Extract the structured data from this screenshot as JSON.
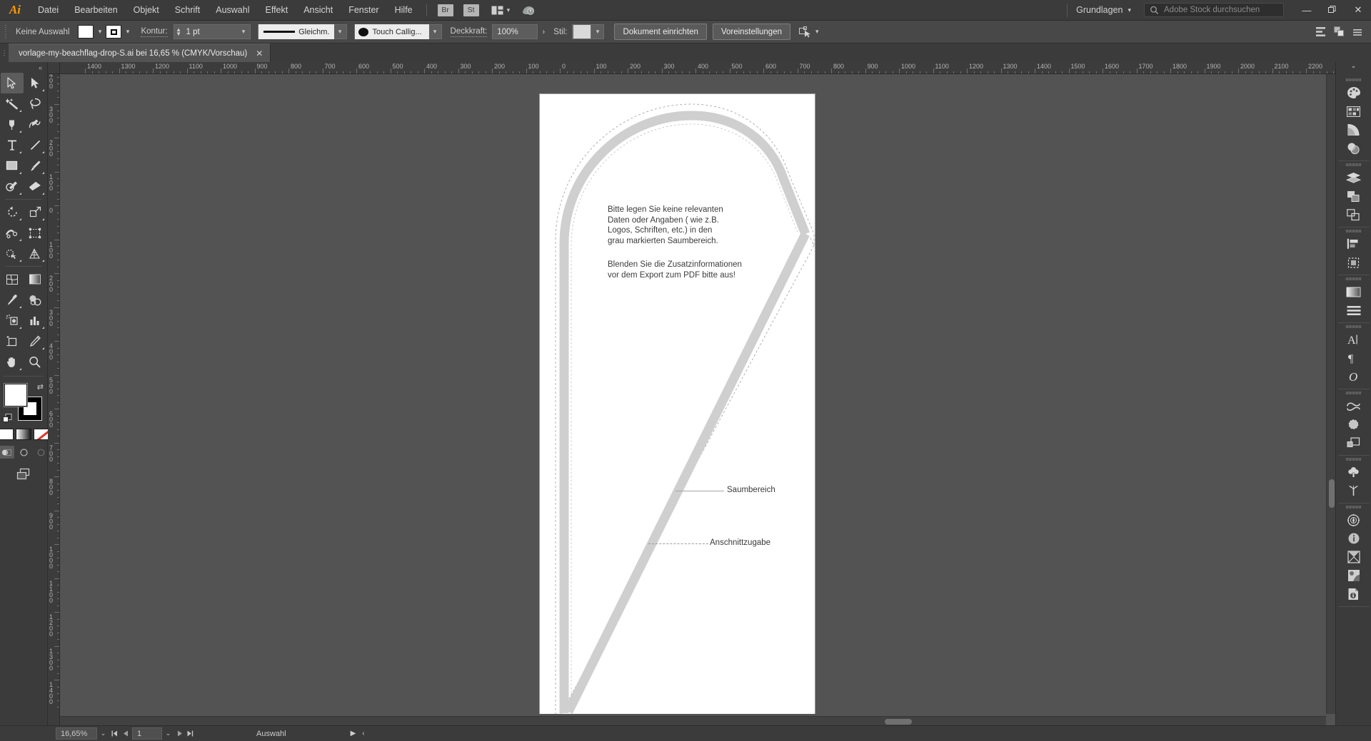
{
  "app": {
    "name": "Adobe Illustrator",
    "logo_text": "Ai"
  },
  "menubar": {
    "items": [
      {
        "label": "Datei"
      },
      {
        "label": "Bearbeiten"
      },
      {
        "label": "Objekt"
      },
      {
        "label": "Schrift"
      },
      {
        "label": "Auswahl"
      },
      {
        "label": "Effekt"
      },
      {
        "label": "Ansicht"
      },
      {
        "label": "Fenster"
      },
      {
        "label": "Hilfe"
      }
    ],
    "bridge_button": "Br",
    "stock_button": "St",
    "arrange_icon": "arrange-documents-icon",
    "cloud_icon": "creative-cloud-icon",
    "workspace": {
      "label": "Grundlagen",
      "caret": "⌄"
    },
    "stock_search": {
      "placeholder": "Adobe Stock durchsuchen",
      "icon": "search-icon"
    },
    "window_controls": {
      "minimize": "—",
      "maximize": "❐",
      "close": "✕"
    }
  },
  "controlbar": {
    "selection_state": "Keine Auswahl",
    "fill_swatch": "#ffffff",
    "stroke_swatch": "#ffffff",
    "stroke_label": "Kontur:",
    "stroke_weight": "1 pt",
    "stroke_profile": "Gleichm.",
    "brush_label": "Touch Callig...",
    "opacity_label": "Deckkraft:",
    "opacity_value": "100%",
    "style_label": "Stil:",
    "style_swatch": "#d9d9d9",
    "document_setup_button": "Dokument einrichten",
    "preferences_button": "Voreinstellungen",
    "select_similar_icon": "select-similar-objects-icon",
    "align_icon": "align-icon",
    "arrange_icon": "arrange-icon",
    "more_options_icon": "more-options-icon"
  },
  "tab": {
    "title": "vorlage-my-beachflag-drop-S.ai bei 16,65 % (CMYK/Vorschau)",
    "close": "✕"
  },
  "toolbar": {
    "collapse": "«",
    "tools": [
      {
        "name": "selection-tool",
        "active": true,
        "corner": false
      },
      {
        "name": "direct-selection-tool",
        "active": false,
        "corner": true
      },
      {
        "name": "magic-wand-tool",
        "active": false,
        "corner": true
      },
      {
        "name": "lasso-tool",
        "active": false,
        "corner": false
      },
      {
        "name": "pen-tool",
        "active": false,
        "corner": true
      },
      {
        "name": "curvature-tool",
        "active": false,
        "corner": false
      },
      {
        "name": "type-tool",
        "active": false,
        "corner": true
      },
      {
        "name": "line-segment-tool",
        "active": false,
        "corner": true
      },
      {
        "name": "rectangle-tool",
        "active": false,
        "corner": true
      },
      {
        "name": "paintbrush-tool",
        "active": false,
        "corner": true
      },
      {
        "name": "shaper-tool",
        "active": false,
        "corner": true
      },
      {
        "name": "eraser-tool",
        "active": false,
        "corner": true
      },
      {
        "name": "rotate-tool",
        "active": false,
        "corner": true
      },
      {
        "name": "scale-tool",
        "active": false,
        "corner": true
      },
      {
        "name": "width-tool",
        "active": false,
        "corner": true
      },
      {
        "name": "free-transform-tool",
        "active": false,
        "corner": false
      },
      {
        "name": "shape-builder-tool",
        "active": false,
        "corner": true
      },
      {
        "name": "perspective-grid-tool",
        "active": false,
        "corner": true
      },
      {
        "name": "mesh-tool",
        "active": false,
        "corner": false
      },
      {
        "name": "gradient-tool",
        "active": false,
        "corner": false
      },
      {
        "name": "eyedropper-tool",
        "active": false,
        "corner": true
      },
      {
        "name": "blend-tool",
        "active": false,
        "corner": false
      },
      {
        "name": "symbol-sprayer-tool",
        "active": false,
        "corner": true
      },
      {
        "name": "column-graph-tool",
        "active": false,
        "corner": true
      },
      {
        "name": "artboard-tool",
        "active": false,
        "corner": false
      },
      {
        "name": "slice-tool",
        "active": false,
        "corner": true
      },
      {
        "name": "hand-tool",
        "active": false,
        "corner": true
      },
      {
        "name": "zoom-tool",
        "active": false,
        "corner": false
      }
    ],
    "fill_color": "#ffffff",
    "stroke_color": "#000000",
    "swap_icon": "swap-fill-stroke-icon",
    "default_icon": "default-fill-stroke-icon",
    "color_modes": [
      {
        "name": "color-mode-button",
        "type": "solid"
      },
      {
        "name": "gradient-mode-button",
        "type": "gradient"
      },
      {
        "name": "none-mode-button",
        "type": "none"
      }
    ],
    "draw_modes": [
      {
        "name": "draw-normal-button",
        "selected": true
      },
      {
        "name": "draw-behind-button",
        "selected": false
      },
      {
        "name": "draw-inside-button",
        "selected": false
      }
    ],
    "screen_mode": "change-screen-mode-button"
  },
  "rulers": {
    "unit": "mm",
    "horizontal_labels": [
      "1400",
      "1300",
      "1200",
      "1100",
      "1000",
      "900",
      "800",
      "700",
      "600",
      "500",
      "400",
      "300",
      "200",
      "100",
      "0",
      "100",
      "200",
      "300",
      "400",
      "500",
      "600",
      "700",
      "800",
      "900",
      "1000",
      "1100",
      "1200",
      "1300",
      "1400",
      "1500",
      "1600",
      "1700",
      "1800",
      "1900",
      "2000",
      "2100",
      "2200"
    ],
    "vertical_labels": [
      "400",
      "300",
      "200",
      "100",
      "0",
      "100",
      "200",
      "300",
      "400",
      "500",
      "600",
      "700",
      "800",
      "900",
      "1000",
      "1100",
      "1200",
      "1300",
      "1400"
    ]
  },
  "canvas": {
    "artboard": {
      "background": "#ffffff",
      "instruction_block_1": "Bitte legen Sie keine relevanten\nDaten oder Angaben ( wie z.B.\nLogos, Schriften, etc.) in den\ngrau markierten Saumbereich.",
      "instruction_block_2": "Blenden Sie die Zusatzinformationen\nvor dem Export zum PDF bitte aus!",
      "annotations": [
        {
          "label": "Saumbereich",
          "name": "annotation-saumbereich"
        },
        {
          "label": "Anschnittzugabe",
          "name": "annotation-anschnittzugabe"
        }
      ],
      "seam_color": "#cfcfcf",
      "bleed_line_color": "#9a9a9a"
    }
  },
  "dock": {
    "collapse": "⌃",
    "groups": [
      {
        "icons": [
          {
            "name": "color-panel-icon"
          },
          {
            "name": "color-guide-panel-icon"
          },
          {
            "name": "color-themes-panel-icon"
          },
          {
            "name": "transparency-panel-icon"
          }
        ]
      },
      {
        "icons": [
          {
            "name": "layers-panel-icon"
          },
          {
            "name": "pathfinder-panel-icon"
          },
          {
            "name": "align-panel-icon"
          }
        ]
      },
      {
        "icons": [
          {
            "name": "transform-panel-icon"
          },
          {
            "name": "artboards-panel-icon"
          }
        ]
      },
      {
        "icons": [
          {
            "name": "gradient-panel-icon"
          },
          {
            "name": "stroke-panel-icon"
          }
        ]
      },
      {
        "icons": [
          {
            "name": "character-panel-icon"
          },
          {
            "name": "paragraph-panel-icon"
          },
          {
            "name": "glyphs-panel-icon"
          }
        ]
      },
      {
        "icons": [
          {
            "name": "brushes-panel-icon"
          },
          {
            "name": "symbols-panel-icon"
          },
          {
            "name": "graphic-styles-panel-icon"
          }
        ]
      },
      {
        "icons": [
          {
            "name": "swatches-panel-icon"
          },
          {
            "name": "libraries-panel-icon"
          }
        ]
      },
      {
        "icons": [
          {
            "name": "navigator-panel-icon"
          },
          {
            "name": "info-panel-icon"
          },
          {
            "name": "separations-preview-panel-icon"
          },
          {
            "name": "image-trace-panel-icon"
          },
          {
            "name": "document-info-panel-icon"
          }
        ]
      }
    ]
  },
  "statusbar": {
    "zoom_level": "16,65%",
    "zoom_caret": "⌄",
    "page_first": "⏮",
    "page_prev": "◀",
    "page_number": "1",
    "page_caret": "⌄",
    "page_next": "▶",
    "page_last": "⏭",
    "status_text": "Auswahl",
    "play_icon": "▶",
    "chevron_icon": "‹"
  }
}
